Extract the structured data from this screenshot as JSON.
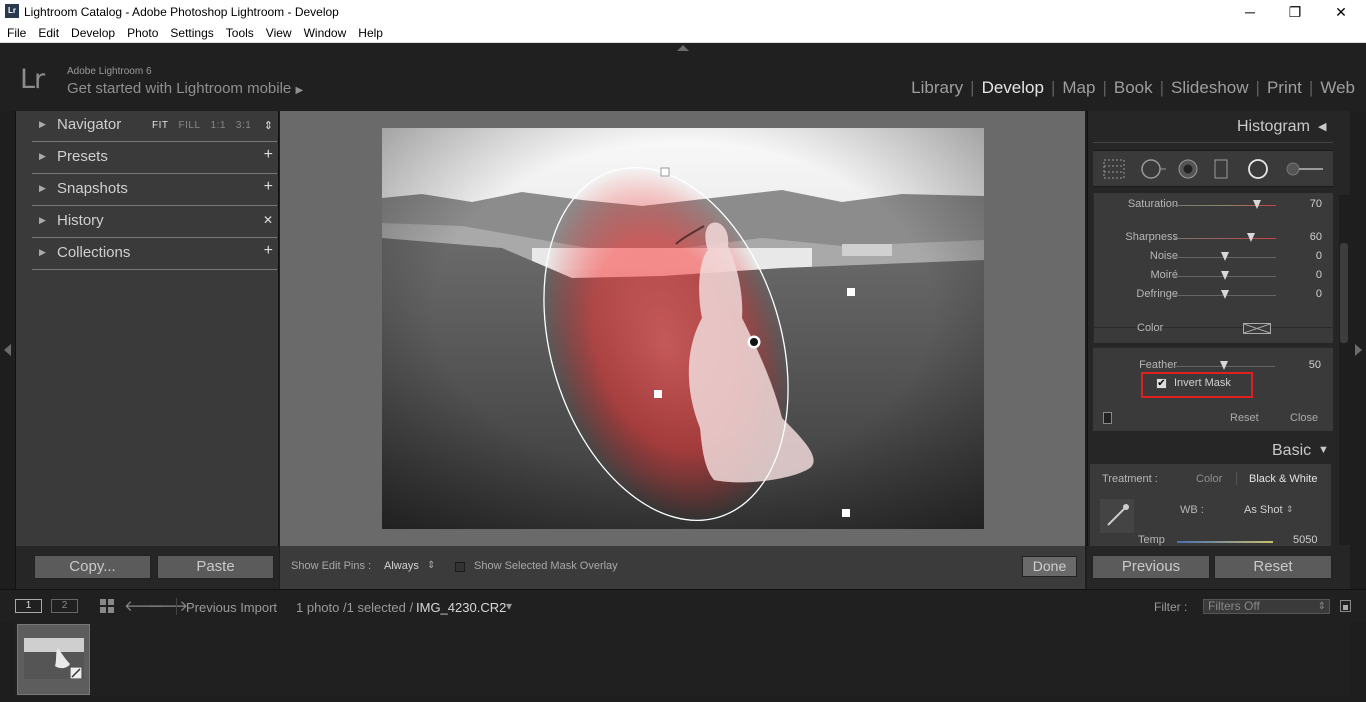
{
  "window": {
    "title": "Lightroom Catalog - Adobe Photoshop Lightroom - Develop",
    "app_icon": "Lr",
    "minimize_glyph": "─",
    "maximize_glyph": "❐",
    "close_glyph": "✕"
  },
  "menu": [
    "File",
    "Edit",
    "Develop",
    "Photo",
    "Settings",
    "Tools",
    "View",
    "Window",
    "Help"
  ],
  "header": {
    "logo": "Lr",
    "brand_line1": "Adobe Lightroom 6",
    "brand_line2": "Get started with Lightroom mobile",
    "brand_arrow": "▶",
    "modules": [
      "Library",
      "Develop",
      "Map",
      "Book",
      "Slideshow",
      "Print",
      "Web"
    ],
    "active_module": "Develop",
    "separator": "|"
  },
  "left_panel": {
    "sections": [
      {
        "label": "Navigator",
        "action": ""
      },
      {
        "label": "Presets",
        "action": "+"
      },
      {
        "label": "Snapshots",
        "action": "+"
      },
      {
        "label": "History",
        "action": "✕"
      },
      {
        "label": "Collections",
        "action": "+"
      }
    ],
    "zoom_options": [
      "FIT",
      "FILL",
      "1:1",
      "3:1"
    ],
    "zoom_active": "FIT",
    "zoom_arrows": "⇕",
    "expand_glyph": "▶",
    "copy_label": "Copy...",
    "paste_label": "Paste"
  },
  "toolbar": {
    "show_edit_pins_label": "Show Edit Pins :",
    "show_edit_pins_value": "Always",
    "value_arrows": "⇕",
    "mask_overlay_label": "Show Selected Mask Overlay",
    "done_label": "Done"
  },
  "right_panel": {
    "histogram_label": "Histogram",
    "collapse_left": "◀",
    "collapse_down": "▼",
    "sliders": [
      {
        "name": "Saturation",
        "value": "70",
        "pos": 0.82
      },
      {
        "name": "Sharpness",
        "value": "60",
        "pos": 0.76
      },
      {
        "name": "Noise",
        "value": "0",
        "pos": 0.5
      },
      {
        "name": "Moiré",
        "value": "0",
        "pos": 0.5
      },
      {
        "name": "Defringe",
        "value": "0",
        "pos": 0.5
      }
    ],
    "color_label": "Color",
    "feather": {
      "name": "Feather",
      "value": "50",
      "pos": 0.5
    },
    "invert_mask_label": "Invert Mask",
    "invert_mask_checked": "✔",
    "reset_label": "Reset",
    "close_label": "Close",
    "basic_label": "Basic",
    "treatment_label": "Treatment :",
    "treatment_color": "Color",
    "treatment_bw": "Black & White",
    "wb_label": "WB :",
    "wb_value": "As Shot",
    "wb_arrows": "⇕",
    "temp_label": "Temp",
    "temp_value": "5050",
    "previous_label": "Previous",
    "reset_button_label": "Reset"
  },
  "filmstrip": {
    "view1": "1",
    "view2": "2",
    "back_arrow": "🡐",
    "forward_arrow": "🡒",
    "source": "Previous Import",
    "count": "1 photo /1 selected /",
    "filename": "IMG_4230.CR2",
    "dropdown": "▾",
    "filter_label": "Filter :",
    "filter_value": "Filters Off",
    "filter_arrows": "⇕"
  },
  "colors": {
    "accent_red": "#e02020",
    "panel": "#3a3a3a",
    "background": "#262626"
  }
}
